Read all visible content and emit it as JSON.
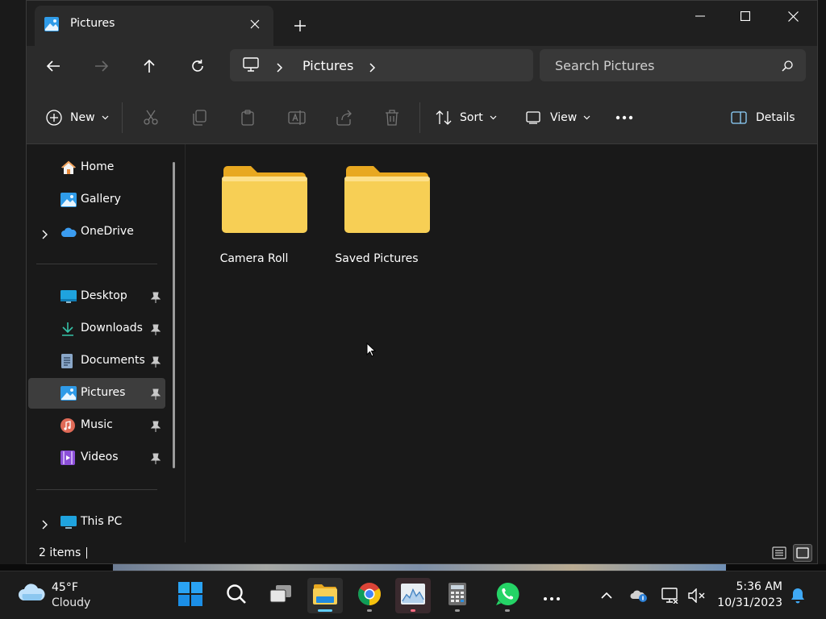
{
  "window": {
    "tab_title": "Pictures",
    "close_tab_icon": "close-icon",
    "new_tab_icon": "plus-icon"
  },
  "window_controls": [
    "minimize",
    "maximize",
    "close"
  ],
  "navigation": {
    "back_icon": "arrow-left-icon",
    "forward_icon": "arrow-right-icon",
    "up_icon": "arrow-up-icon",
    "refresh_icon": "refresh-icon",
    "address": {
      "root_icon": "monitor-icon",
      "crumb": "Pictures"
    },
    "search": {
      "placeholder": "Search Pictures",
      "value": ""
    }
  },
  "command_bar": {
    "new_label": "New",
    "disabled_icons": [
      "cut-icon",
      "copy-icon",
      "paste-icon",
      "rename-icon",
      "share-icon",
      "delete-icon"
    ],
    "sort_label": "Sort",
    "view_label": "View",
    "more_icon": "ellipsis-icon",
    "details_label": "Details"
  },
  "sidebar": {
    "group1": [
      {
        "label": "Home",
        "icon": "home-icon",
        "expandable": false
      },
      {
        "label": "Gallery",
        "icon": "gallery-icon",
        "expandable": false
      },
      {
        "label": "OneDrive",
        "icon": "cloud-icon",
        "expandable": true
      }
    ],
    "quick_access": [
      {
        "label": "Desktop",
        "icon": "desktop-icon",
        "pinned": true
      },
      {
        "label": "Downloads",
        "icon": "download-icon",
        "pinned": true
      },
      {
        "label": "Documents",
        "icon": "documents-icon",
        "pinned": true
      },
      {
        "label": "Pictures",
        "icon": "pictures-icon",
        "pinned": true,
        "selected": true
      },
      {
        "label": "Music",
        "icon": "music-icon",
        "pinned": true
      },
      {
        "label": "Videos",
        "icon": "videos-icon",
        "pinned": true
      }
    ],
    "group3": [
      {
        "label": "This PC",
        "icon": "pc-icon",
        "expandable": true
      }
    ]
  },
  "content": {
    "folders": [
      {
        "name": "Camera Roll",
        "icon": "folder-icon"
      },
      {
        "name": "Saved Pictures",
        "icon": "folder-icon"
      }
    ]
  },
  "status": {
    "items_text": "2 items"
  },
  "taskbar": {
    "weather": {
      "temp": "45°F",
      "condition": "Cloudy",
      "icon": "cloud-icon"
    },
    "apps": [
      {
        "name": "start",
        "icon": "windows-icon"
      },
      {
        "name": "search",
        "icon": "search-icon"
      },
      {
        "name": "task-view",
        "icon": "task-view-icon"
      },
      {
        "name": "file-explorer",
        "icon": "folder-icon",
        "running": true,
        "active": true
      },
      {
        "name": "chrome",
        "icon": "chrome-icon",
        "running": true
      },
      {
        "name": "task-manager",
        "icon": "chart-icon",
        "running": true
      },
      {
        "name": "calculator",
        "icon": "calculator-icon",
        "running": true
      },
      {
        "name": "whatsapp",
        "icon": "whatsapp-icon",
        "running": true
      },
      {
        "name": "more",
        "icon": "ellipsis-icon"
      }
    ],
    "tray": [
      "chevron-up-icon",
      "onedrive-icon",
      "network-icon",
      "volume-muted-icon"
    ],
    "clock": {
      "time": "5:36 AM",
      "date": "10/31/2023"
    },
    "notification_icon": "bell-icon"
  },
  "colors": {
    "accent": "#60cdff",
    "folder": "#f6c94b",
    "window_bg": "#191919",
    "toolbar_bg": "#2b2b2b"
  }
}
